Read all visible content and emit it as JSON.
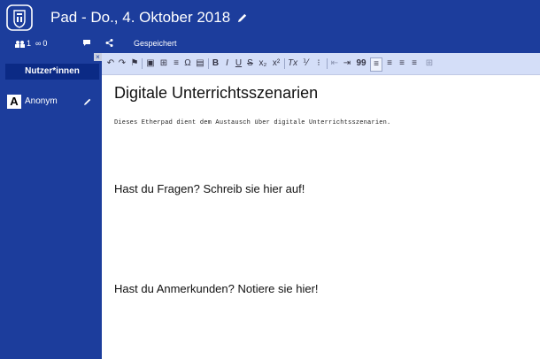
{
  "header": {
    "title": "Pad - Do., 4. Oktober 2018",
    "edit_icon": "pencil-icon",
    "color": "#1c3d9c"
  },
  "subbar": {
    "users_count": "1",
    "infinity_count": "0",
    "status": "Gespeichert",
    "icons": [
      "users-icon",
      "infinity-icon",
      "chat-icon",
      "share-icon"
    ]
  },
  "sidebar": {
    "users_header": "Nutzer*innen",
    "close_label": "×",
    "users": [
      {
        "avatar_letter": "A",
        "name": "Anonym"
      }
    ]
  },
  "toolbar": {
    "color": "#d4def8",
    "buttons": [
      "undo",
      "redo",
      "bookmark",
      "image",
      "table",
      "horizontal-rule",
      "special-char",
      "paste",
      "bold",
      "italic",
      "underline",
      "strikethrough",
      "subscript",
      "superscript",
      "remove-format",
      "ordered-list",
      "bullet-list",
      "outdent",
      "indent",
      "blockquote",
      "align-left",
      "align-center",
      "align-right",
      "justify",
      "more"
    ],
    "labels": {
      "bold": "B",
      "italic": "I",
      "underline": "U",
      "strike": "S",
      "sub": "x₂",
      "sup": "x²",
      "omega": "Ω",
      "quote": "99",
      "more": "⊞"
    }
  },
  "editor": {
    "heading": "Digitale Unterrichtsszenarien",
    "intro": "Dieses Etherpad dient dem Austausch über digitale Unterrichtsszenarien.",
    "question1": "Hast du Fragen? Schreib sie hier auf!",
    "question2": "Hast du Anmerkunden? Notiere sie hier!"
  }
}
